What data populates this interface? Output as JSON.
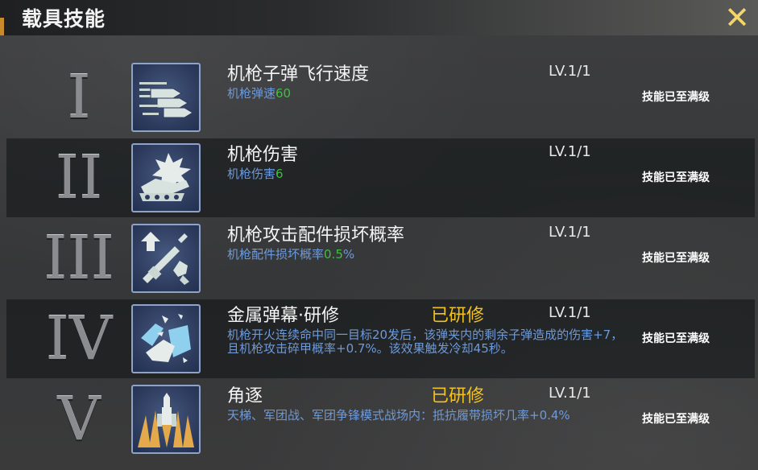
{
  "header": {
    "title": "载具技能",
    "close_glyph": "✕"
  },
  "skills": [
    {
      "numeral": "I",
      "icon": "bullet-speed-icon",
      "name": "机枪子弹飞行速度",
      "researched": "",
      "level": "LV.1/1",
      "desc_prefix": "机枪弹速",
      "desc_value": "60",
      "desc_suffix": "",
      "status": "技能已至满级"
    },
    {
      "numeral": "II",
      "icon": "tank-damage-icon",
      "name": "机枪伤害",
      "researched": "",
      "level": "LV.1/1",
      "desc_prefix": "机枪伤害",
      "desc_value": "6",
      "desc_suffix": "",
      "status": "技能已至满级"
    },
    {
      "numeral": "III",
      "icon": "machine-gun-upgrade-icon",
      "name": "机枪攻击配件损坏概率",
      "researched": "",
      "level": "LV.1/1",
      "desc_prefix": "机枪配件损坏概率",
      "desc_value": "0.5",
      "desc_suffix": "%",
      "status": "技能已至满级"
    },
    {
      "numeral": "IV",
      "icon": "metal-barrage-icon",
      "name": "金属弹幕·研修",
      "researched": "已研修",
      "level": "LV.1/1",
      "desc_prefix": "机枪开火连续命中同一目标20发后，该弹夹内的剩余子弹造成的伤害+7，且机枪攻击碎甲概率+0.7%。该效果触发冷却45秒。",
      "desc_value": "",
      "desc_suffix": "",
      "status": "技能已至满级"
    },
    {
      "numeral": "V",
      "icon": "horn-formation-icon",
      "name": "角逐",
      "researched": "已研修",
      "level": "LV.1/1",
      "desc_prefix": "天梯、军团战、军团争锋模式战场内：抵抗履带损坏几率+0.4%",
      "desc_value": "",
      "desc_suffix": "",
      "status": "技能已至满级"
    }
  ]
}
